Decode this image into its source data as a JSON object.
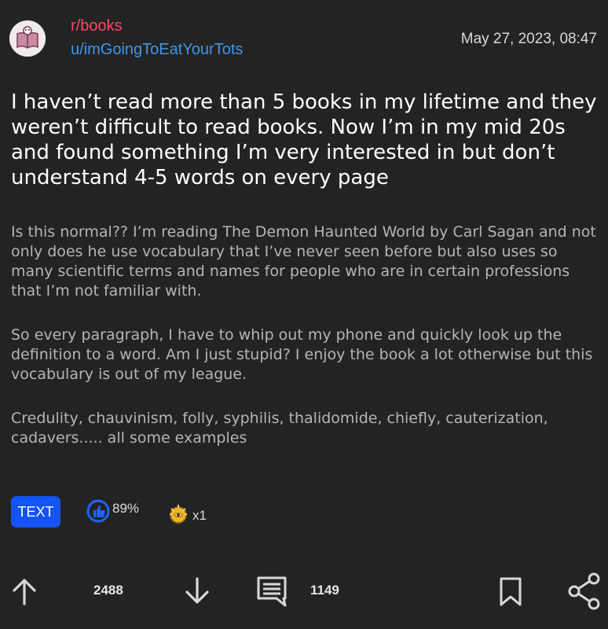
{
  "post": {
    "subreddit": "r/books",
    "author": "u/imGoingToEatYourTots",
    "timestamp": "May 27, 2023, 08:47",
    "title": "I haven’t read more than 5 books in my lifetime and they weren’t difficult to read books. Now I’m in my mid 20s and found something I’m very interested in but don’t understand 4-5 words on every page",
    "paragraphs": [
      "Is this normal?? I’m reading The Demon Haunted World by Carl Sagan and not only does he use vocabulary that I’ve never seen before but also uses so many scientific terms and names for people who are in certain professions that I’m not familiar with.",
      "So every paragraph, I have to whip out my phone and quickly look up the definition to a word. Am I just stupid? I enjoy the book a lot otherwise but this vocabulary is out of my league.",
      "Credulity, chauvinism, folly, syphilis, thalidomide, chiefly, cauterization, cadavers..... all some examples"
    ],
    "flair": "TEXT",
    "upvote_ratio": "89%",
    "award_count": "x1",
    "score": "2488",
    "comment_count": "1149"
  },
  "colors": {
    "background": "#232323",
    "subreddit": "#ff4468",
    "username": "#3f97e8",
    "flair_bg": "#1454f5",
    "body_text": "#b5b5b5"
  },
  "icons": {
    "upvote": "arrow-up-icon",
    "downvote": "arrow-down-icon",
    "comments": "comment-icon",
    "save": "bookmark-icon",
    "share": "share-icon",
    "ratio": "thumbs-up-icon",
    "award": "award-icon"
  }
}
